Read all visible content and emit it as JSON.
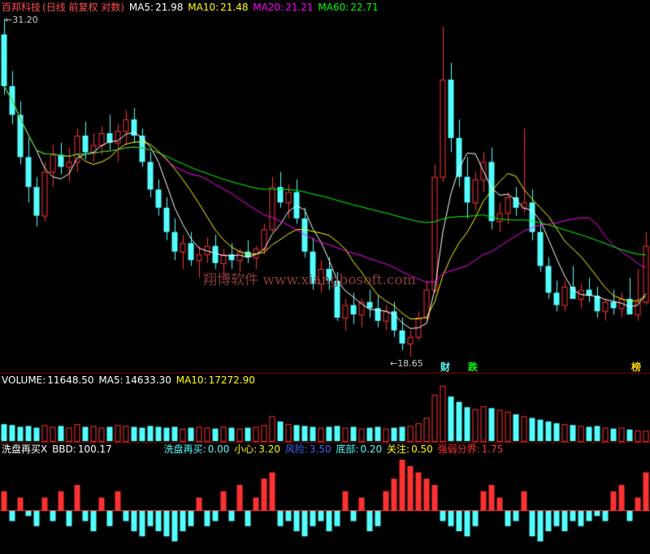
{
  "main_header": {
    "name": "百邦科技",
    "mode": "(日线 前复权 对数)",
    "ma5_label": "MA5:",
    "ma5_value": "21.98",
    "ma10_label": "MA10:",
    "ma10_value": "21.48",
    "ma20_label": "MA20:",
    "ma20_value": "21.21",
    "ma60_label": "MA60:",
    "ma60_value": "22.71"
  },
  "price_labels": {
    "high": "31.20",
    "low": "18.65"
  },
  "watermark": "翔博软件 www.xiangbosoft.com",
  "tags": {
    "cai": "财",
    "die": "跌",
    "bang": "榜"
  },
  "volume_header": {
    "label": "VOLUME:",
    "value": "11648.50",
    "ma5_label": "MA5:",
    "ma5_value": "14633.30",
    "ma10_label": "MA10:",
    "ma10_value": "17272.90"
  },
  "indicator_header": {
    "name": "洗盘再买X",
    "bbd_label": "BBD:",
    "bbd_value": "100.17",
    "xp_label": "洗盘再买:",
    "xp_value": "0.00",
    "xx_label": "小心:",
    "xx_value": "3.20",
    "fx_label": "风险:",
    "fx_value": "3.50",
    "db_label": "底部:",
    "db_value": "0.20",
    "gz_label": "关注:",
    "gz_value": "0.50",
    "qr_label": "强弱分界:",
    "qr_value": "1.75"
  },
  "colors": {
    "up": "#ff3232",
    "down": "#54ffff",
    "ma5": "#ffffff",
    "ma10": "#ffff00",
    "ma20": "#ff00ff",
    "ma60": "#00ff00",
    "grid": "#8b0000",
    "header": "#ff5050"
  },
  "chart_data": {
    "type": "candlestick",
    "ohlc": [
      [
        30.4,
        31.2,
        27.5,
        27.9
      ],
      [
        27.9,
        28.6,
        26.2,
        26.6
      ],
      [
        26.6,
        27.2,
        24.5,
        24.8
      ],
      [
        24.8,
        25.6,
        23.0,
        23.6
      ],
      [
        23.6,
        24.0,
        22.1,
        22.5
      ],
      [
        22.5,
        24.6,
        22.3,
        24.2
      ],
      [
        24.2,
        25.3,
        23.6,
        24.9
      ],
      [
        24.9,
        25.4,
        24.1,
        24.4
      ],
      [
        24.4,
        25.2,
        23.8,
        24.6
      ],
      [
        24.6,
        26.0,
        24.2,
        25.7
      ],
      [
        25.7,
        26.3,
        24.7,
        25.0
      ],
      [
        25.0,
        25.8,
        24.6,
        25.3
      ],
      [
        25.3,
        26.1,
        24.9,
        25.8
      ],
      [
        25.8,
        26.6,
        25.1,
        25.4
      ],
      [
        25.4,
        26.2,
        24.6,
        25.9
      ],
      [
        25.9,
        26.8,
        25.3,
        26.4
      ],
      [
        26.4,
        26.9,
        25.4,
        25.7
      ],
      [
        25.7,
        26.0,
        24.4,
        24.6
      ],
      [
        24.6,
        25.0,
        23.2,
        23.5
      ],
      [
        23.5,
        23.9,
        22.5,
        22.8
      ],
      [
        22.8,
        23.2,
        21.6,
        21.9
      ],
      [
        21.9,
        22.4,
        20.9,
        21.2
      ],
      [
        21.2,
        21.8,
        20.6,
        21.5
      ],
      [
        21.5,
        21.9,
        20.7,
        20.9
      ],
      [
        20.9,
        21.4,
        20.3,
        21.1
      ],
      [
        21.1,
        21.7,
        20.8,
        21.4
      ],
      [
        21.4,
        21.8,
        20.6,
        20.8
      ],
      [
        20.8,
        21.3,
        20.4,
        21.1
      ],
      [
        21.1,
        21.5,
        20.6,
        20.9
      ],
      [
        20.9,
        21.3,
        20.5,
        21.2
      ],
      [
        21.2,
        21.6,
        20.8,
        21.0
      ],
      [
        21.0,
        21.4,
        20.6,
        21.3
      ],
      [
        21.3,
        22.2,
        21.1,
        22.0
      ],
      [
        22.0,
        24.0,
        21.9,
        23.6
      ],
      [
        23.6,
        24.2,
        22.8,
        23.0
      ],
      [
        23.0,
        23.7,
        22.4,
        23.4
      ],
      [
        23.4,
        23.9,
        22.2,
        22.4
      ],
      [
        22.4,
        22.8,
        21.0,
        21.2
      ],
      [
        21.2,
        21.7,
        19.9,
        20.1
      ],
      [
        20.1,
        20.9,
        19.8,
        20.6
      ],
      [
        20.6,
        21.0,
        19.9,
        20.2
      ],
      [
        20.2,
        20.5,
        18.9,
        19.0
      ],
      [
        19.0,
        19.6,
        18.6,
        19.4
      ],
      [
        19.4,
        19.8,
        18.8,
        19.1
      ],
      [
        19.1,
        19.6,
        18.7,
        19.5
      ],
      [
        19.5,
        19.9,
        19.0,
        19.3
      ],
      [
        19.3,
        19.7,
        18.7,
        18.9
      ],
      [
        18.9,
        19.4,
        18.6,
        19.2
      ],
      [
        19.2,
        19.5,
        18.4,
        18.6
      ],
      [
        18.6,
        19.0,
        18.0,
        18.2
      ],
      [
        18.2,
        18.6,
        17.8,
        18.4
      ],
      [
        18.4,
        19.2,
        18.3,
        19.0
      ],
      [
        19.0,
        20.2,
        18.9,
        19.9
      ],
      [
        19.9,
        24.5,
        19.8,
        24.0
      ],
      [
        24.0,
        30.8,
        23.8,
        28.2
      ],
      [
        28.2,
        29.0,
        25.0,
        25.6
      ],
      [
        25.6,
        26.4,
        23.6,
        24.0
      ],
      [
        24.0,
        24.8,
        22.4,
        23.0
      ],
      [
        23.0,
        24.2,
        22.7,
        23.9
      ],
      [
        23.9,
        25.0,
        23.4,
        24.6
      ],
      [
        24.6,
        25.2,
        22.0,
        22.3
      ],
      [
        22.3,
        23.0,
        21.9,
        22.6
      ],
      [
        22.6,
        23.4,
        22.2,
        23.2
      ],
      [
        23.2,
        23.6,
        22.5,
        22.8
      ],
      [
        22.8,
        26.0,
        22.6,
        23.0
      ],
      [
        23.0,
        23.5,
        21.6,
        21.9
      ],
      [
        21.9,
        22.2,
        20.5,
        20.7
      ],
      [
        20.7,
        21.0,
        19.6,
        19.8
      ],
      [
        19.8,
        20.2,
        19.2,
        19.4
      ],
      [
        19.4,
        20.2,
        19.2,
        20.0
      ],
      [
        20.0,
        20.7,
        19.8,
        19.6
      ],
      [
        19.6,
        20.1,
        19.3,
        19.9
      ],
      [
        19.9,
        20.3,
        19.5,
        19.7
      ],
      [
        19.7,
        20.0,
        19.0,
        19.2
      ],
      [
        19.2,
        19.6,
        18.9,
        19.5
      ],
      [
        19.5,
        19.9,
        19.1,
        19.3
      ],
      [
        19.3,
        19.8,
        19.0,
        19.6
      ],
      [
        19.6,
        20.3,
        19.4,
        19.1
      ],
      [
        19.1,
        20.6,
        18.9,
        19.5
      ],
      [
        19.5,
        21.9,
        19.4,
        21.4
      ]
    ],
    "volume": [
      1.9,
      1.8,
      1.6,
      1.7,
      1.5,
      1.8,
      1.6,
      1.7,
      1.5,
      1.9,
      1.6,
      1.7,
      1.5,
      1.6,
      1.8,
      1.7,
      1.6,
      1.5,
      1.7,
      1.6,
      1.5,
      1.6,
      1.4,
      1.5,
      1.6,
      1.5,
      1.4,
      1.6,
      1.5,
      1.4,
      1.5,
      1.6,
      1.8,
      2.8,
      2.2,
      1.9,
      1.8,
      1.7,
      1.6,
      1.5,
      1.6,
      1.7,
      1.5,
      1.6,
      1.4,
      1.5,
      1.6,
      1.4,
      1.5,
      1.6,
      1.7,
      2.0,
      2.6,
      5.2,
      6.2,
      5.0,
      4.4,
      3.8,
      3.6,
      3.9,
      3.7,
      3.5,
      3.3,
      3.0,
      2.8,
      2.6,
      2.4,
      2.2,
      2.0,
      1.9,
      1.8,
      1.7,
      1.6,
      1.7,
      1.5,
      1.4,
      1.5,
      1.3,
      1.2,
      1.16
    ],
    "bbd_bars": [
      3,
      -2,
      2,
      -1,
      -3,
      2,
      -2,
      3,
      -3,
      4,
      -2,
      -4,
      2,
      -3,
      3,
      -2,
      -4,
      -5,
      -3,
      -4,
      -5,
      -6,
      -4,
      -3,
      2,
      -3,
      -2,
      3,
      -2,
      4,
      -3,
      2,
      5,
      6,
      -3,
      -2,
      -4,
      -5,
      -3,
      -2,
      -4,
      -3,
      3,
      -2,
      2,
      -4,
      -3,
      3,
      5,
      8,
      7,
      6,
      5,
      4,
      -2,
      -3,
      -4,
      -5,
      -3,
      3,
      4,
      2,
      -3,
      -2,
      3,
      -5,
      -6,
      -4,
      -3,
      -4,
      -2,
      -3,
      -2,
      -1,
      -2,
      3,
      4,
      -2,
      2,
      6
    ],
    "ylim": [
      17.5,
      31.5
    ],
    "y_scale": "log"
  }
}
